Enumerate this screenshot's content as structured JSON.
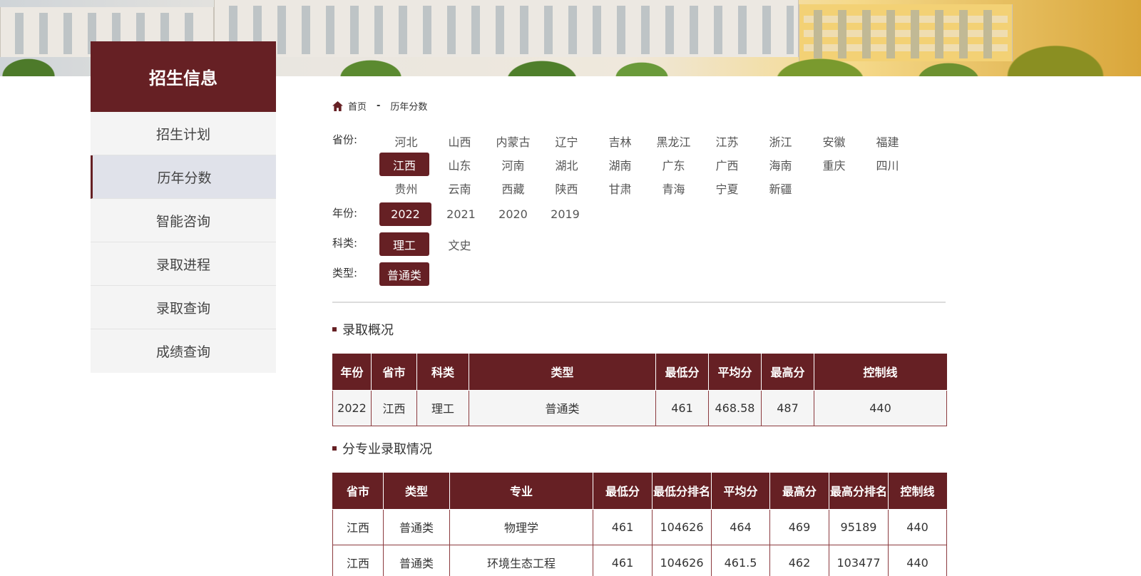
{
  "sidebar": {
    "title": "招生信息",
    "items": [
      {
        "label": "招生计划"
      },
      {
        "label": "历年分数"
      },
      {
        "label": "智能咨询"
      },
      {
        "label": "录取进程"
      },
      {
        "label": "录取查询"
      },
      {
        "label": "成绩查询"
      }
    ],
    "active_index": 1
  },
  "breadcrumb": {
    "home": "首页",
    "separator": "-",
    "current": "历年分数"
  },
  "filters": {
    "province": {
      "label": "省份:",
      "options": [
        "河北",
        "山西",
        "内蒙古",
        "辽宁",
        "吉林",
        "黑龙江",
        "江苏",
        "浙江",
        "安徽",
        "福建",
        "江西",
        "山东",
        "河南",
        "湖北",
        "湖南",
        "广东",
        "广西",
        "海南",
        "重庆",
        "四川",
        "贵州",
        "云南",
        "西藏",
        "陕西",
        "甘肃",
        "青海",
        "宁夏",
        "新疆"
      ],
      "selected": "江西"
    },
    "year": {
      "label": "年份:",
      "options": [
        "2022",
        "2021",
        "2020",
        "2019"
      ],
      "selected": "2022"
    },
    "subject": {
      "label": "科类:",
      "options": [
        "理工",
        "文史"
      ],
      "selected": "理工"
    },
    "type": {
      "label": "类型:",
      "options": [
        "普通类"
      ],
      "selected": "普通类"
    }
  },
  "overview": {
    "title": "录取概况",
    "columns": [
      "年份",
      "省市",
      "科类",
      "类型",
      "最低分",
      "平均分",
      "最高分",
      "控制线"
    ],
    "rows": [
      [
        "2022",
        "江西",
        "理工",
        "普通类",
        "461",
        "468.58",
        "487",
        "440"
      ]
    ]
  },
  "majors": {
    "title": "分专业录取情况",
    "columns": [
      "省市",
      "类型",
      "专业",
      "最低分",
      "最低分排名",
      "平均分",
      "最高分",
      "最高分排名",
      "控制线"
    ],
    "rows": [
      [
        "江西",
        "普通类",
        "物理学",
        "461",
        "104626",
        "464",
        "469",
        "95189",
        "440"
      ],
      [
        "江西",
        "普通类",
        "环境生态工程",
        "461",
        "104626",
        "461.5",
        "462",
        "103477",
        "440"
      ]
    ]
  },
  "colors": {
    "brand": "#662024",
    "menu_bg": "#f4f4f4",
    "menu_active_bg": "#e0e2ea"
  }
}
